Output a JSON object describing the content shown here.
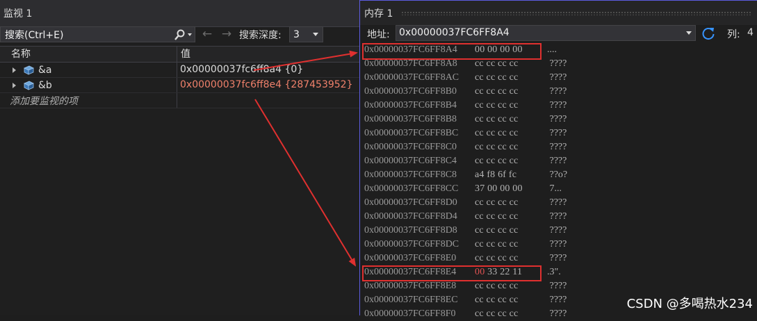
{
  "watch": {
    "title": "监视 1",
    "search_placeholder": "搜索(Ctrl+E)",
    "depth_label": "搜索深度:",
    "depth_value": "3",
    "columns": [
      "名称",
      "值"
    ],
    "rows": [
      {
        "name": "&a",
        "value": "0x00000037fc6ff8a4 {0}",
        "changed": false
      },
      {
        "name": "&b",
        "value": "0x00000037fc6ff8e4 {287453952}",
        "changed": true
      }
    ],
    "add_item": "添加要监视的项"
  },
  "memory": {
    "title": "内存 1",
    "address_label": "地址:",
    "address_value": "0x00000037FC6FF8A4",
    "columns_label": "列:",
    "columns_value": "4",
    "rows": [
      {
        "addr": "0x00000037FC6FF8A4",
        "hex": "00 00 00 00",
        "ascii": "...."
      },
      {
        "addr": "0x00000037FC6FF8A8",
        "hex": "cc cc cc cc",
        "ascii": " ????"
      },
      {
        "addr": "0x00000037FC6FF8AC",
        "hex": "cc cc cc cc",
        "ascii": " ????"
      },
      {
        "addr": "0x00000037FC6FF8B0",
        "hex": "cc cc cc cc",
        "ascii": " ????"
      },
      {
        "addr": "0x00000037FC6FF8B4",
        "hex": "cc cc cc cc",
        "ascii": " ????"
      },
      {
        "addr": "0x00000037FC6FF8B8",
        "hex": "cc cc cc cc",
        "ascii": " ????"
      },
      {
        "addr": "0x00000037FC6FF8BC",
        "hex": "cc cc cc cc",
        "ascii": " ????"
      },
      {
        "addr": "0x00000037FC6FF8C0",
        "hex": "cc cc cc cc",
        "ascii": " ????"
      },
      {
        "addr": "0x00000037FC6FF8C4",
        "hex": "cc cc cc cc",
        "ascii": " ????"
      },
      {
        "addr": "0x00000037FC6FF8C8",
        "hex": "a4 f8 6f fc",
        "ascii": " ??o?"
      },
      {
        "addr": "0x00000037FC6FF8CC",
        "hex": "37 00 00 00",
        "ascii": " 7..."
      },
      {
        "addr": "0x00000037FC6FF8D0",
        "hex": "cc cc cc cc",
        "ascii": " ????"
      },
      {
        "addr": "0x00000037FC6FF8D4",
        "hex": "cc cc cc cc",
        "ascii": " ????"
      },
      {
        "addr": "0x00000037FC6FF8D8",
        "hex": "cc cc cc cc",
        "ascii": " ????"
      },
      {
        "addr": "0x00000037FC6FF8DC",
        "hex": "cc cc cc cc",
        "ascii": " ????"
      },
      {
        "addr": "0x00000037FC6FF8E0",
        "hex": "cc cc cc cc",
        "ascii": " ????"
      },
      {
        "addr": "0x00000037FC6FF8E4",
        "hex": "00 33 22 11",
        "ascii": ".3\"."
      },
      {
        "addr": "0x00000037FC6FF8E8",
        "hex": "cc cc cc cc",
        "ascii": " ????"
      },
      {
        "addr": "0x00000037FC6FF8EC",
        "hex": "cc cc cc cc",
        "ascii": " ????"
      },
      {
        "addr": "0x00000037FC6FF8F0",
        "hex": "cc cc cc cc",
        "ascii": " ????"
      }
    ]
  },
  "watermark": "CSDN @多喝热水234",
  "colors": {
    "highlight": "#e0302f",
    "changed_value": "#f0816b",
    "accent": "#5d5ce0"
  }
}
